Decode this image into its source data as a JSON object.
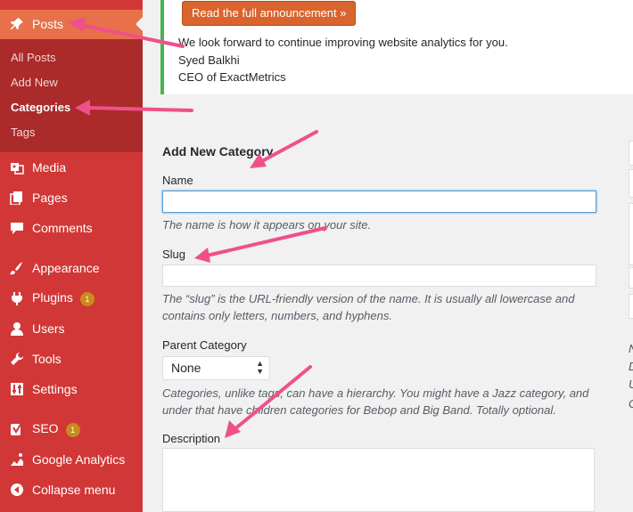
{
  "sidebar": {
    "posts": "Posts",
    "submenu": [
      "All Posts",
      "Add New",
      "Categories",
      "Tags"
    ],
    "items": [
      {
        "label": "Media",
        "icon": "media-icon"
      },
      {
        "label": "Pages",
        "icon": "pages-icon"
      },
      {
        "label": "Comments",
        "icon": "comments-icon"
      },
      {
        "label": "Appearance",
        "icon": "appearance-icon"
      },
      {
        "label": "Plugins",
        "icon": "plugins-icon",
        "badge": "1"
      },
      {
        "label": "Users",
        "icon": "users-icon"
      },
      {
        "label": "Tools",
        "icon": "tools-icon"
      },
      {
        "label": "Settings",
        "icon": "settings-icon"
      },
      {
        "label": "SEO",
        "icon": "seo-icon",
        "badge": "1"
      },
      {
        "label": "Google Analytics",
        "icon": "analytics-icon"
      },
      {
        "label": "Collapse menu",
        "icon": "collapse-icon"
      }
    ]
  },
  "notice": {
    "button": "Read the full announcement »",
    "line1": "We look forward to continue improving website analytics for you.",
    "line2": "Syed Balkhi",
    "line3": "CEO of ExactMetrics"
  },
  "form": {
    "heading": "Add New Category",
    "name_label": "Name",
    "name_help": "The name is how it appears on your site.",
    "slug_label": "Slug",
    "slug_help_1": "The “slug” is the URL-friendly version of the name. It is usually all lowercase and",
    "slug_help_2": "contains only letters, numbers, and hyphens.",
    "parent_label": "Parent Category",
    "parent_value": "None",
    "parent_help_1": "Categories, unlike tags, can have a hierarchy. You might have a Jazz category, and",
    "parent_help_2": "under that have children categories for Bebop and Big Band. Totally optional.",
    "description_label": "Description"
  },
  "right_clipped_letters": [
    "N",
    "D",
    "U",
    "C"
  ],
  "colors": {
    "sidebar": "#d23737",
    "submenu": "#ab2a2a",
    "active": "#e8704a",
    "button": "#d9642e",
    "notice_border": "#46b450",
    "arrow": "#f0508a"
  }
}
